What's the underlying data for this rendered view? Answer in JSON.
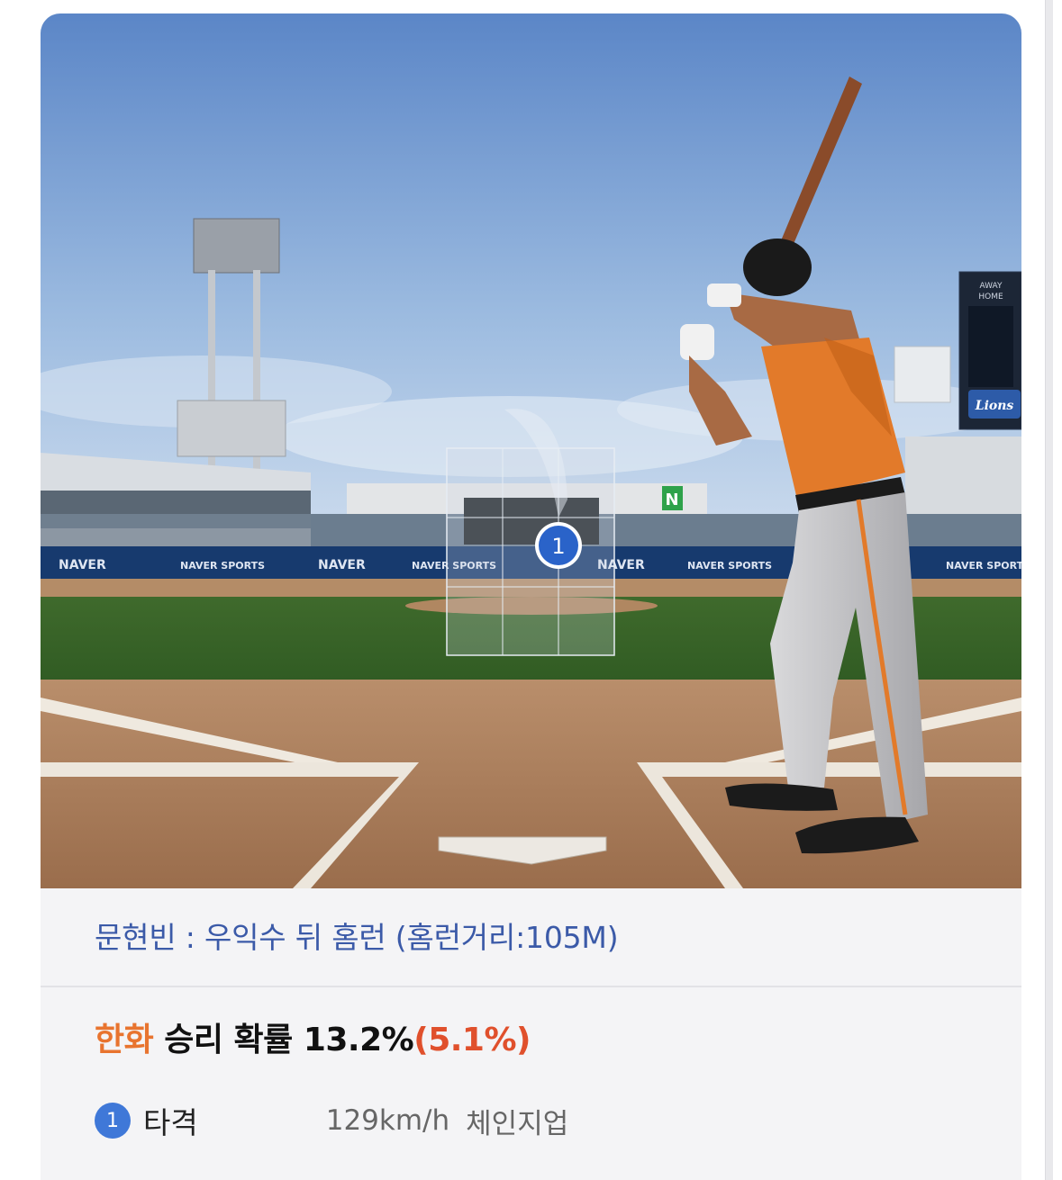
{
  "scene": {
    "boards": [
      "NAVER",
      "NAVER SPORTS",
      "NAVER",
      "NAVER SPORTS",
      "NAVER",
      "NAVER SPORTS",
      "NAVER SPORTS"
    ],
    "green_badge": "N",
    "marker_number": "1",
    "scoreboard_top": "AWAY",
    "scoreboard_home": "HOME",
    "team_logo": "Lions"
  },
  "caption": "문현빈 : 우익수 뒤 홈런 (홈런거리:105M)",
  "win_prob": {
    "team": "한화",
    "text": " 승리 확률 13.2%",
    "delta": "(5.1%)"
  },
  "pitch": {
    "number": "1",
    "label": "타격",
    "speed": "129km/h",
    "type": "체인지업"
  },
  "colors": {
    "caption_blue": "#3b5aa8",
    "team_orange": "#e8742f",
    "delta_red": "#e0502c",
    "marker_blue": "#3f78d8"
  }
}
